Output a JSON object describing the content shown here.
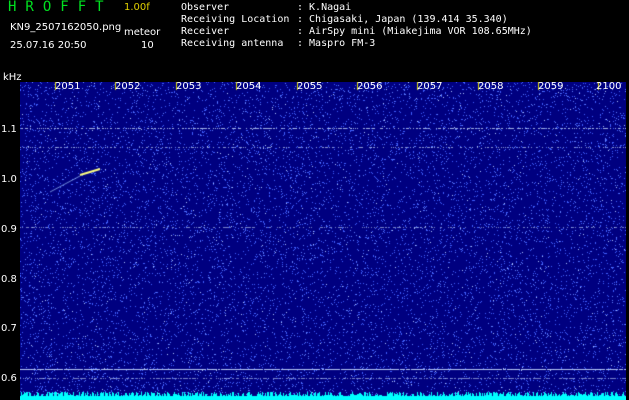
{
  "header": {
    "logo_text": "HROFFT",
    "version": "1.00f",
    "filename": "KN9_2507162050.png",
    "mode": "meteor",
    "timestamp": "25.07.16 20:50",
    "count": "10"
  },
  "station_info": [
    {
      "label": "Observer",
      "value": ": K.Nagai"
    },
    {
      "label": "Receiving Location",
      "value": ": Chigasaki, Japan (139.414 35.340)"
    },
    {
      "label": "Receiver",
      "value": ": AirSpy mini (Miakejima VOR 108.65MHz)"
    },
    {
      "label": "Receiving antenna",
      "value": ": Maspro FM-3"
    }
  ],
  "spectrogram": {
    "y_unit": "kHz",
    "y_ticks": [
      "1.1",
      "1.0",
      "0.9",
      "0.8",
      "0.7",
      "0.6"
    ],
    "x_ticks": [
      "2051",
      "2052",
      "2053",
      "2054",
      "2055",
      "2056",
      "2057",
      "2058",
      "2059",
      "2100"
    ],
    "colors": {
      "background": "#000080",
      "noise": "#4060ff",
      "signal": "#00ffff",
      "text": "#ffffff"
    }
  }
}
